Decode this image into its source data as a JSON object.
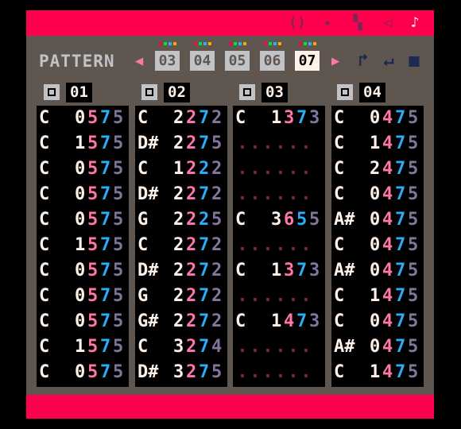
{
  "toolbar": {
    "tools": [
      {
        "icon": "code-editor-icon",
        "glyph": "()"
      },
      {
        "icon": "sprite-editor-icon",
        "glyph": "✦"
      },
      {
        "icon": "map-editor-icon",
        "glyph": "▚"
      },
      {
        "icon": "sfx-editor-icon",
        "glyph": "◁"
      },
      {
        "icon": "music-editor-icon",
        "glyph": "♪"
      }
    ]
  },
  "pattern": {
    "label": "PATTERN",
    "prev_arrow": "◀",
    "next_arrow": "▶",
    "numbers": [
      "03",
      "04",
      "05",
      "06",
      "07"
    ],
    "active_index": 4,
    "dot_colors": [
      [
        "#ff004d",
        "#00e436",
        "#29adff",
        "#ffa300"
      ],
      [
        "#ff004d",
        "#00e436",
        "#29adff",
        "#ffa300"
      ],
      [
        "#ff004d",
        "#00e436",
        "#29adff",
        "#ffa300"
      ],
      [
        "#ff004d",
        "#00e436",
        "#29adff",
        "#ffa300"
      ],
      [
        "#ff004d",
        "#00e436",
        "#29adff",
        "#ffa300"
      ]
    ],
    "controls": [
      {
        "icon": "loop-start-icon",
        "glyph": "↱"
      },
      {
        "icon": "loop-back-icon",
        "glyph": "↵"
      },
      {
        "icon": "stop-icon",
        "glyph": "■"
      }
    ]
  },
  "channels": [
    {
      "number": "01",
      "rows": [
        {
          "note": "C",
          "oct": "0",
          "inst": "5",
          "vol": "7",
          "fx": "5"
        },
        {
          "note": "C",
          "oct": "1",
          "inst": "5",
          "vol": "7",
          "fx": "5"
        },
        {
          "note": "C",
          "oct": "0",
          "inst": "5",
          "vol": "7",
          "fx": "5"
        },
        {
          "note": "C",
          "oct": "0",
          "inst": "5",
          "vol": "7",
          "fx": "5"
        },
        {
          "note": "C",
          "oct": "0",
          "inst": "5",
          "vol": "7",
          "fx": "5"
        },
        {
          "note": "C",
          "oct": "1",
          "inst": "5",
          "vol": "7",
          "fx": "5"
        },
        {
          "note": "C",
          "oct": "0",
          "inst": "5",
          "vol": "7",
          "fx": "5"
        },
        {
          "note": "C",
          "oct": "0",
          "inst": "5",
          "vol": "7",
          "fx": "5"
        },
        {
          "note": "C",
          "oct": "0",
          "inst": "5",
          "vol": "7",
          "fx": "5"
        },
        {
          "note": "C",
          "oct": "1",
          "inst": "5",
          "vol": "7",
          "fx": "5"
        },
        {
          "note": "C",
          "oct": "0",
          "inst": "5",
          "vol": "7",
          "fx": "5"
        }
      ]
    },
    {
      "number": "02",
      "rows": [
        {
          "note": "C",
          "oct": "2",
          "inst": "2",
          "vol": "7",
          "fx": "2"
        },
        {
          "note": "D#",
          "oct": "2",
          "inst": "2",
          "vol": "7",
          "fx": "5"
        },
        {
          "note": "C",
          "oct": "1",
          "inst": "2",
          "vol": "2",
          "fx": "2"
        },
        {
          "note": "D#",
          "oct": "2",
          "inst": "2",
          "vol": "7",
          "fx": "2"
        },
        {
          "note": "G",
          "oct": "2",
          "inst": "2",
          "vol": "2",
          "fx": "5"
        },
        {
          "note": "C",
          "oct": "2",
          "inst": "2",
          "vol": "7",
          "fx": "2"
        },
        {
          "note": "D#",
          "oct": "2",
          "inst": "2",
          "vol": "7",
          "fx": "2"
        },
        {
          "note": "G",
          "oct": "2",
          "inst": "2",
          "vol": "7",
          "fx": "2"
        },
        {
          "note": "G#",
          "oct": "2",
          "inst": "2",
          "vol": "7",
          "fx": "2"
        },
        {
          "note": "C",
          "oct": "3",
          "inst": "2",
          "vol": "7",
          "fx": "4"
        },
        {
          "note": "D#",
          "oct": "3",
          "inst": "2",
          "vol": "7",
          "fx": "5"
        }
      ]
    },
    {
      "number": "03",
      "rows": [
        {
          "note": "C",
          "oct": "1",
          "inst": "3",
          "vol": "7",
          "fx": "3"
        },
        {
          "note": "",
          "oct": "",
          "inst": "",
          "vol": "",
          "fx": ""
        },
        {
          "note": "",
          "oct": "",
          "inst": "",
          "vol": "",
          "fx": ""
        },
        {
          "note": "",
          "oct": "",
          "inst": "",
          "vol": "",
          "fx": ""
        },
        {
          "note": "C",
          "oct": "3",
          "inst": "6",
          "vol": "5",
          "fx": "5"
        },
        {
          "note": "",
          "oct": "",
          "inst": "",
          "vol": "",
          "fx": ""
        },
        {
          "note": "C",
          "oct": "1",
          "inst": "3",
          "vol": "7",
          "fx": "3"
        },
        {
          "note": "",
          "oct": "",
          "inst": "",
          "vol": "",
          "fx": ""
        },
        {
          "note": "C",
          "oct": "1",
          "inst": "4",
          "vol": "7",
          "fx": "3"
        },
        {
          "note": "",
          "oct": "",
          "inst": "",
          "vol": "",
          "fx": ""
        },
        {
          "note": "",
          "oct": "",
          "inst": "",
          "vol": "",
          "fx": ""
        }
      ]
    },
    {
      "number": "04",
      "rows": [
        {
          "note": "C",
          "oct": "0",
          "inst": "4",
          "vol": "7",
          "fx": "5"
        },
        {
          "note": "C",
          "oct": "1",
          "inst": "4",
          "vol": "7",
          "fx": "5"
        },
        {
          "note": "C",
          "oct": "2",
          "inst": "4",
          "vol": "7",
          "fx": "5"
        },
        {
          "note": "C",
          "oct": "0",
          "inst": "4",
          "vol": "7",
          "fx": "5"
        },
        {
          "note": "A#",
          "oct": "0",
          "inst": "4",
          "vol": "7",
          "fx": "5"
        },
        {
          "note": "C",
          "oct": "0",
          "inst": "4",
          "vol": "7",
          "fx": "5"
        },
        {
          "note": "A#",
          "oct": "0",
          "inst": "4",
          "vol": "7",
          "fx": "5"
        },
        {
          "note": "C",
          "oct": "1",
          "inst": "4",
          "vol": "7",
          "fx": "5"
        },
        {
          "note": "C",
          "oct": "0",
          "inst": "4",
          "vol": "7",
          "fx": "5"
        },
        {
          "note": "A#",
          "oct": "0",
          "inst": "4",
          "vol": "7",
          "fx": "5"
        },
        {
          "note": "C",
          "oct": "1",
          "inst": "4",
          "vol": "7",
          "fx": "5"
        }
      ]
    }
  ],
  "empty_marker": ".",
  "colors": {
    "frame": "#5f574f",
    "bar": "#ff004d",
    "note": "#fff1e8",
    "instrument": "#ff77a8",
    "volume": "#29adff",
    "effect": "#83769c",
    "empty": "#7e2553"
  }
}
